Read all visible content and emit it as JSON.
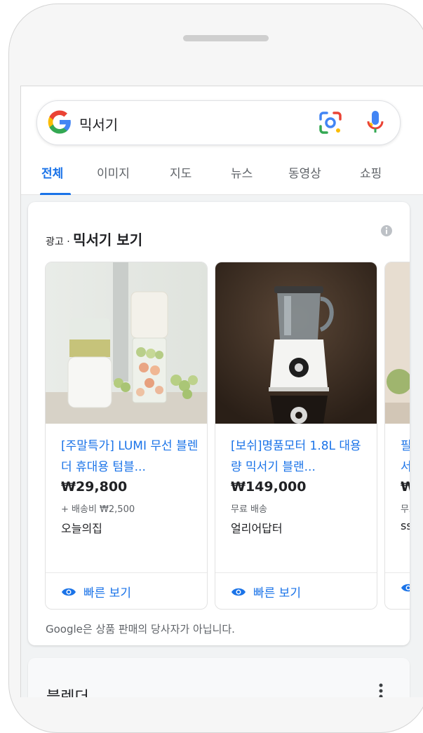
{
  "search": {
    "query": "믹서기"
  },
  "tabs": [
    {
      "label": "전체"
    },
    {
      "label": "이미지"
    },
    {
      "label": "지도"
    },
    {
      "label": "뉴스"
    },
    {
      "label": "동영상"
    },
    {
      "label": "쇼핑"
    }
  ],
  "ads": {
    "label": "광고 · ",
    "title": "믹서기 보기",
    "quick_view_label": "빠른 보기",
    "disclaimer": "Google은 상품 판매의 당사자가 아닙니다.",
    "products": [
      {
        "title": "[주말특가] LUMI 무선 블렌더 휴대용 텀블...",
        "price": "₩29,800",
        "shipping": "+ 배송비 ₩2,500",
        "store": "오늘의집"
      },
      {
        "title": "[보쉬]명품모터 1.8L 대용량 믹서기 블랜...",
        "price": "₩149,000",
        "shipping": "무료 배송",
        "store": "얼리어답터"
      },
      {
        "title": "필터\n서가",
        "price": "₩:",
        "shipping": "무료",
        "store": "ss"
      }
    ]
  },
  "bottom_card": {
    "title": "블렌더"
  },
  "colors": {
    "link": "#1a73e8",
    "text": "#202124",
    "muted": "#5f6368"
  }
}
